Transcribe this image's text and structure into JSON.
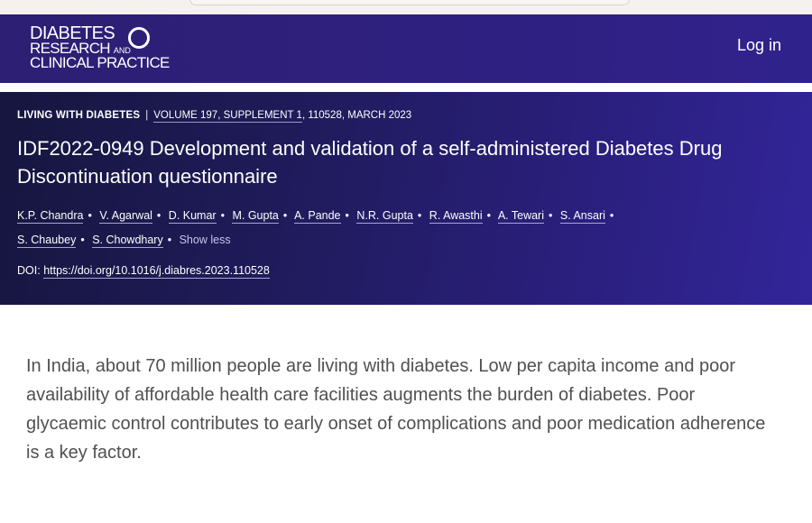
{
  "journal": {
    "logo_line1": "DIABETES",
    "logo_line2": "RESEARCH",
    "logo_line2_small": "AND",
    "logo_line3": "CLINICAL PRACTICE",
    "login_label": "Log in"
  },
  "article": {
    "section": "LIVING WITH DIABETES",
    "separator": "|",
    "volume": "VOLUME 197, SUPPLEMENT 1",
    "details": ", 110528, MARCH 2023",
    "title": "IDF2022-0949 Development and validation of a self-administered Diabetes Drug Discontinuation questionnaire",
    "authors": [
      "K.P. Chandra",
      "V. Agarwal",
      "D. Kumar",
      "M. Gupta",
      "A. Pande",
      "N.R. Gupta",
      "R. Awasthi",
      "A. Tewari",
      "S. Ansari",
      "S. Chaubey",
      "S. Chowdhary"
    ],
    "author_separator": "•",
    "show_less_label": "Show less",
    "doi_label": "DOI:",
    "doi_link": "https://doi.org/10.1016/j.diabres.2023.110528"
  },
  "abstract": {
    "text": "In India, about 70 million people are living with diabetes. Low per capita income and poor availability of affordable health care facilities augments the burden of diabetes. Poor glycaemic control contributes to early onset of complications and poor medication adherence is a key factor."
  },
  "colors": {
    "header_bg": "#2e2080",
    "hero_bg_start": "#16163f",
    "hero_bg_end": "#32259a",
    "abstract_text": "#505050"
  }
}
